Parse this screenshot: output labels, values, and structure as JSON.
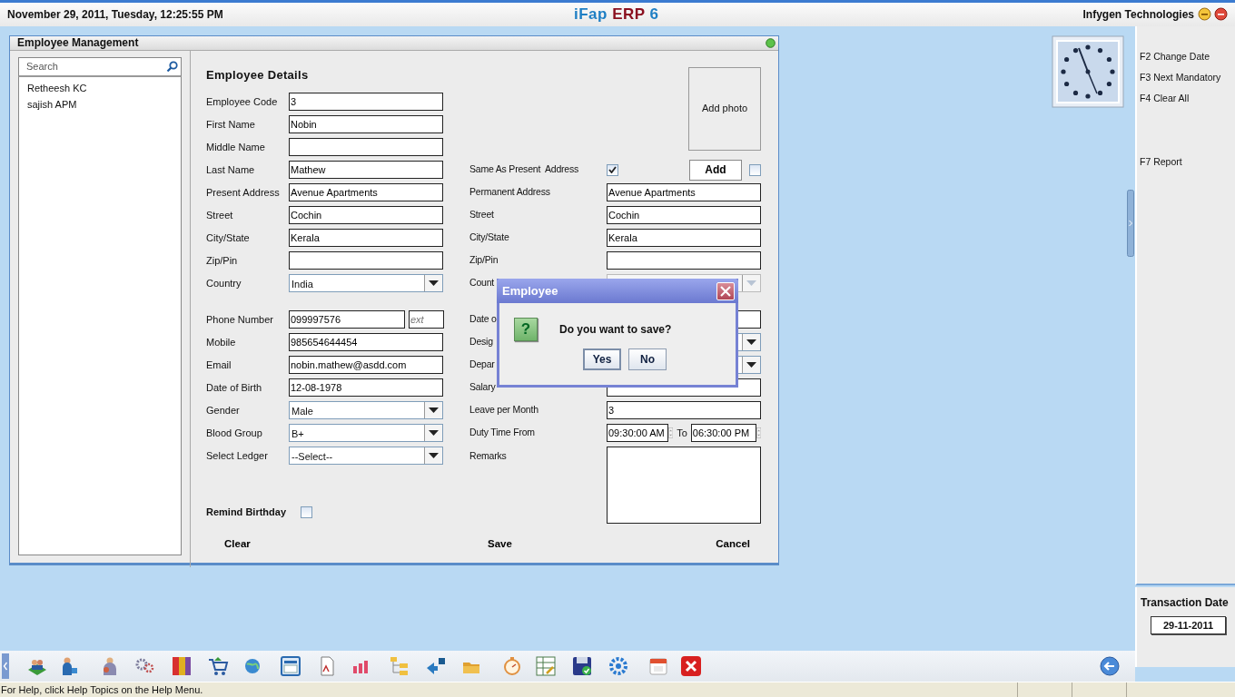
{
  "header": {
    "datetime": "November  29, 2011, Tuesday, 12:25:55 PM",
    "title_parts": [
      {
        "text": "iFap",
        "color": "#1f7fc4"
      },
      {
        "text": "ERP",
        "color": "#8b1020"
      },
      {
        "text": "6",
        "color": "#1f7fc4"
      }
    ],
    "company": "Infygen Technologies"
  },
  "window": {
    "title": "Employee Management"
  },
  "search": {
    "placeholder": "Search"
  },
  "employees": [
    {
      "name": "Retheesh KC"
    },
    {
      "name": "sajish APM"
    }
  ],
  "form": {
    "title": "Employee Details",
    "photo": {
      "label": "Add photo",
      "button": "Add",
      "attach_checked": false
    },
    "rows": [
      {
        "left": {
          "kind": "text",
          "label": "Employee Code",
          "value": "3"
        }
      },
      {
        "left": {
          "kind": "text",
          "label": "First Name",
          "value": "Nobin"
        }
      },
      {
        "left": {
          "kind": "text",
          "label": "Middle Name"
        }
      },
      {
        "left": {
          "kind": "text",
          "label": "Last Name",
          "value": "Mathew"
        },
        "right": {
          "kind": "checkbox",
          "label": "Same As Present  Address",
          "checked": true
        }
      },
      {
        "left": {
          "kind": "text",
          "label": "Present Address",
          "value": "Avenue Apartments"
        },
        "right": {
          "kind": "text",
          "label": "Permanent Address",
          "value": "Avenue Apartments"
        }
      },
      {
        "left": {
          "kind": "text",
          "label": "Street",
          "value": "Cochin"
        },
        "right": {
          "kind": "text",
          "label": "Street",
          "value": "Cochin"
        }
      },
      {
        "left": {
          "kind": "text",
          "label": "City/State",
          "value": "Kerala"
        },
        "right": {
          "kind": "text",
          "label": "City/State",
          "value": "Kerala"
        }
      },
      {
        "left": {
          "kind": "text",
          "label": "Zip/Pin"
        },
        "right": {
          "kind": "text",
          "label": "Zip/Pin"
        }
      },
      {
        "left": {
          "kind": "select",
          "label": "Country",
          "value": "India",
          "disabled": false
        },
        "right": {
          "kind": "select",
          "label": "Count",
          "disabled": true
        }
      },
      {
        "left": {
          "kind": "phone",
          "label": "Phone Number",
          "value": "099997576",
          "ext_placeholder": "ext"
        },
        "right": {
          "kind": "text",
          "label": "Date o"
        }
      },
      {
        "left": {
          "kind": "text",
          "label": "Mobile",
          "value": "985654644454"
        },
        "right": {
          "kind": "select",
          "label": "Desig",
          "disabled": false
        }
      },
      {
        "left": {
          "kind": "text",
          "label": "Email",
          "value": "nobin.mathew@asdd.com"
        },
        "right": {
          "kind": "select",
          "label": "Depar",
          "disabled": false
        }
      },
      {
        "left": {
          "kind": "text",
          "label": "Date of Birth",
          "value": "12-08-1978"
        },
        "right": {
          "kind": "text",
          "label": "Salary"
        }
      },
      {
        "left": {
          "kind": "select",
          "label": "Gender",
          "value": "Male",
          "disabled": false
        },
        "right": {
          "kind": "text",
          "label": "Leave per Month",
          "value": "3"
        }
      },
      {
        "left": {
          "kind": "select",
          "label": "Blood Group",
          "value": "B+",
          "disabled": false
        },
        "right": {
          "kind": "time_range",
          "label": "Duty Time From",
          "from": "09:30:00 AM",
          "to_label": "To",
          "to": "06:30:00 PM"
        }
      },
      {
        "left": {
          "kind": "select",
          "label": "Select Ledger",
          "value": "--Select--",
          "disabled": false
        },
        "right": {
          "kind": "textarea",
          "label": "Remarks"
        }
      }
    ],
    "remind_birthday": {
      "label": "Remind Birthday",
      "checked": false
    },
    "actions": [
      {
        "label": "Clear"
      },
      {
        "label": "Save"
      },
      {
        "label": "Cancel"
      }
    ]
  },
  "dialog": {
    "title": "Employee",
    "icon_glyph": "?",
    "message": "Do you want to save?",
    "buttons": [
      {
        "label": "Yes",
        "selected": true
      },
      {
        "label": "No",
        "selected": false
      }
    ]
  },
  "function_keys": [
    "F2 Change Date",
    "F3 Next Mandatory",
    "F4 Clear All",
    "F7 Report"
  ],
  "transaction": {
    "label": "Transaction Date",
    "date": "29-11-2011"
  },
  "status_bar": {
    "text": "For Help, click Help Topics on the Help Menu."
  }
}
